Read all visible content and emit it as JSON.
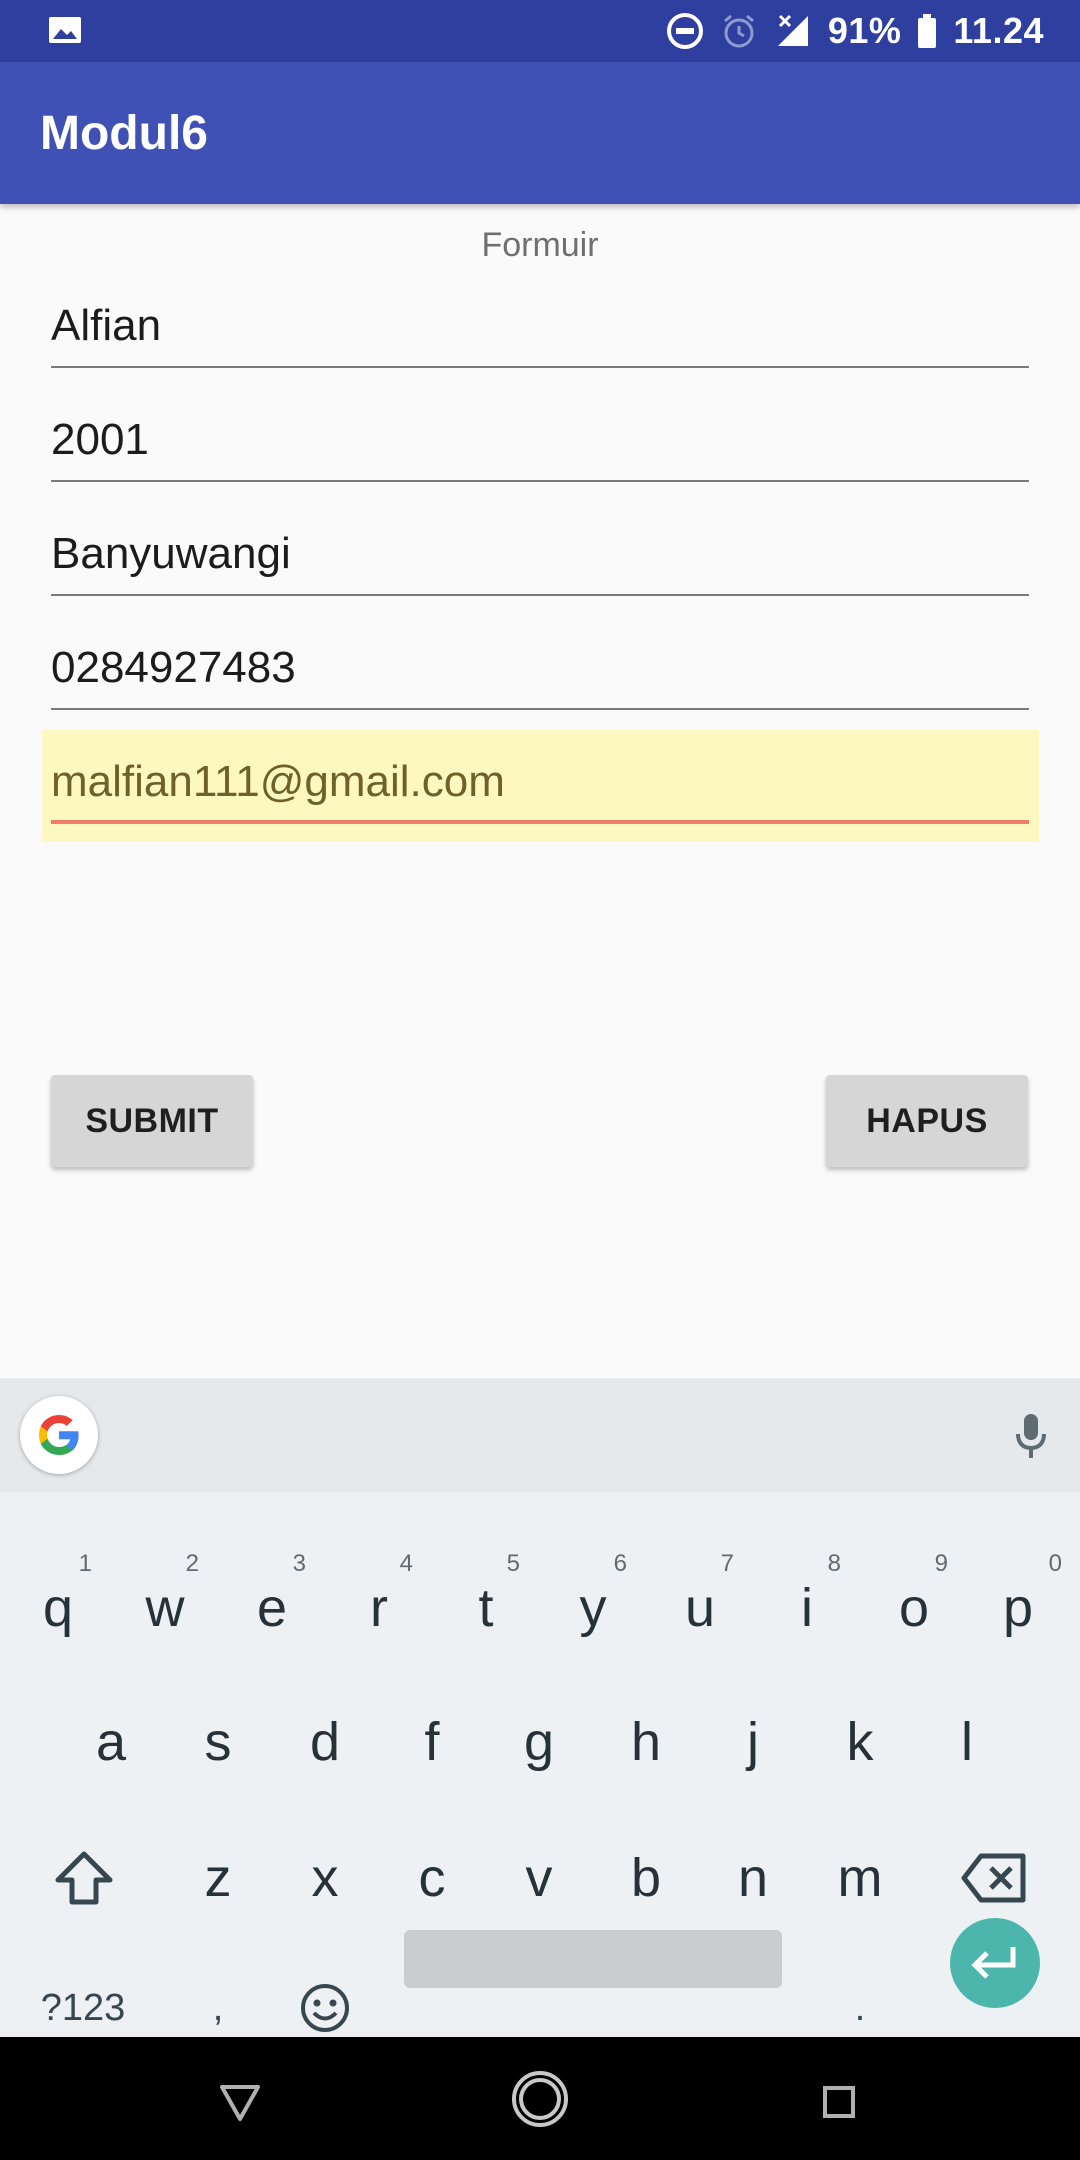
{
  "status_bar": {
    "battery_percent": "91%",
    "time": "11.24",
    "icons": [
      "gallery-icon",
      "do-not-disturb-icon",
      "alarm-icon",
      "signal-icon",
      "battery-icon"
    ]
  },
  "app_bar": {
    "title": "Modul6",
    "color": "#3f51b5"
  },
  "form": {
    "heading": "Formuir",
    "fields": [
      {
        "value": "Alfian"
      },
      {
        "value": "2001"
      },
      {
        "value": "Banyuwangi"
      },
      {
        "value": "0284927483"
      },
      {
        "value": "malfian111@gmail.com",
        "focused": true
      }
    ],
    "submit_label": "SUBMIT",
    "delete_label": "HAPUS"
  },
  "keyboard": {
    "row1": [
      {
        "key": "q",
        "hint": "1"
      },
      {
        "key": "w",
        "hint": "2"
      },
      {
        "key": "e",
        "hint": "3"
      },
      {
        "key": "r",
        "hint": "4"
      },
      {
        "key": "t",
        "hint": "5"
      },
      {
        "key": "y",
        "hint": "6"
      },
      {
        "key": "u",
        "hint": "7"
      },
      {
        "key": "i",
        "hint": "8"
      },
      {
        "key": "o",
        "hint": "9"
      },
      {
        "key": "p",
        "hint": "0"
      }
    ],
    "row2": [
      "a",
      "s",
      "d",
      "f",
      "g",
      "h",
      "j",
      "k",
      "l"
    ],
    "row3": [
      "z",
      "x",
      "c",
      "v",
      "b",
      "n",
      "m"
    ],
    "symbols_label": "?123",
    "comma": ",",
    "period": ".",
    "enter_color": "#4db6ac"
  }
}
